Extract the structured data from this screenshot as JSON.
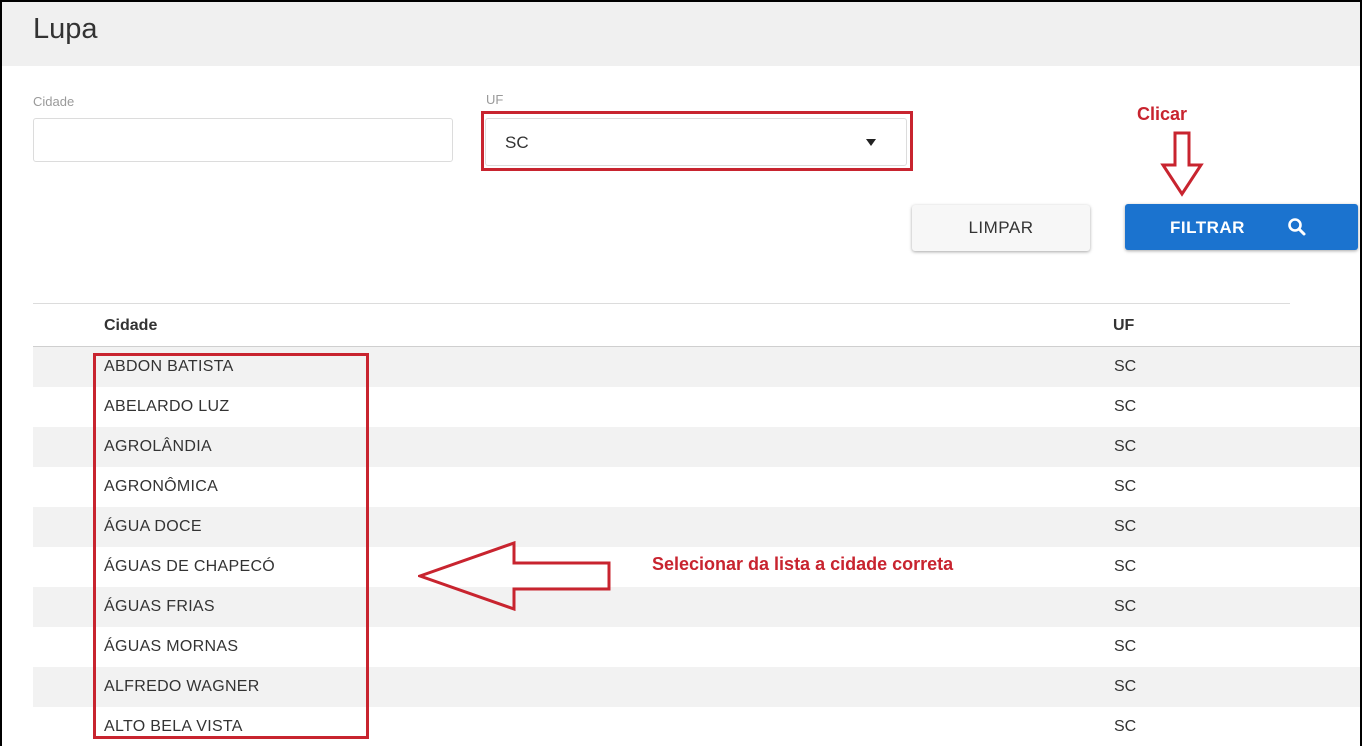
{
  "page": {
    "title": "Lupa"
  },
  "filters": {
    "cidade": {
      "label": "Cidade",
      "value": "",
      "placeholder": ""
    },
    "uf": {
      "label": "UF",
      "value": "SC"
    }
  },
  "buttons": {
    "limpar": "LIMPAR",
    "filtrar": "FILTRAR"
  },
  "annotations": {
    "clicar": "Clicar",
    "selecionar": "Selecionar da lista a cidade correta",
    "color": "#c8242f"
  },
  "table": {
    "headers": {
      "cidade": "Cidade",
      "uf": "UF"
    },
    "rows": [
      {
        "cidade": "ABDON BATISTA",
        "uf": "SC"
      },
      {
        "cidade": "ABELARDO LUZ",
        "uf": "SC"
      },
      {
        "cidade": "AGROLÂNDIA",
        "uf": "SC"
      },
      {
        "cidade": "AGRONÔMICA",
        "uf": "SC"
      },
      {
        "cidade": "ÁGUA DOCE",
        "uf": "SC"
      },
      {
        "cidade": "ÁGUAS DE CHAPECÓ",
        "uf": "SC"
      },
      {
        "cidade": "ÁGUAS FRIAS",
        "uf": "SC"
      },
      {
        "cidade": "ÁGUAS MORNAS",
        "uf": "SC"
      },
      {
        "cidade": "ALFREDO WAGNER",
        "uf": "SC"
      },
      {
        "cidade": "ALTO BELA VISTA",
        "uf": "SC"
      }
    ]
  },
  "colors": {
    "primary": "#1b73cf",
    "header_bg": "#f0f0f0",
    "stripe": "#f2f2f2"
  }
}
